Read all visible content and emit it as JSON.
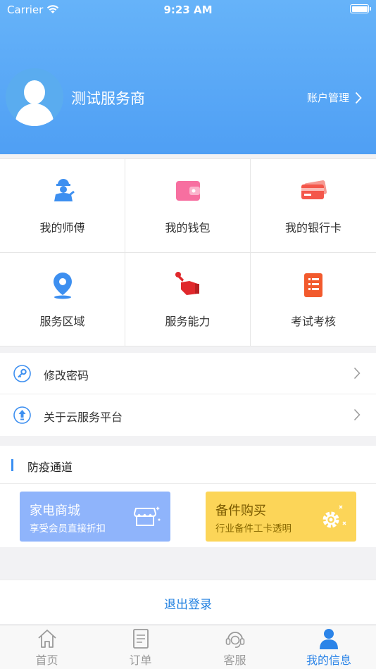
{
  "status_bar": {
    "carrier": "Carrier",
    "time": "9:23 AM"
  },
  "profile": {
    "name": "测试服务商",
    "account_link": "账户管理"
  },
  "grid": [
    {
      "label": "我的师傅",
      "icon": "worker-icon"
    },
    {
      "label": "我的钱包",
      "icon": "wallet-icon"
    },
    {
      "label": "我的银行卡",
      "icon": "bank-card-icon"
    },
    {
      "label": "服务区域",
      "icon": "location-pin-icon"
    },
    {
      "label": "服务能力",
      "icon": "wrench-hand-icon"
    },
    {
      "label": "考试考核",
      "icon": "document-scroll-icon"
    }
  ],
  "list": [
    {
      "label": "修改密码",
      "icon": "key-icon"
    },
    {
      "label": "关于云服务平台",
      "icon": "upload-info-icon"
    }
  ],
  "section": {
    "title": "防疫通道",
    "cards": [
      {
        "title": "家电商城",
        "subtitle": "享受会员直接折扣",
        "icon": "store-icon",
        "color": "#8fb4fb"
      },
      {
        "title": "备件购买",
        "subtitle": "行业备件工卡透明",
        "icon": "gear-icon",
        "color": "#fcd558"
      }
    ]
  },
  "logout_label": "退出登录",
  "tabs": [
    {
      "label": "首页",
      "icon": "home-icon"
    },
    {
      "label": "订单",
      "icon": "order-icon"
    },
    {
      "label": "客服",
      "icon": "headset-icon"
    },
    {
      "label": "我的信息",
      "icon": "person-icon",
      "active": true
    }
  ],
  "colors": {
    "header": "#56a5f6",
    "accent": "#2b84e8"
  }
}
